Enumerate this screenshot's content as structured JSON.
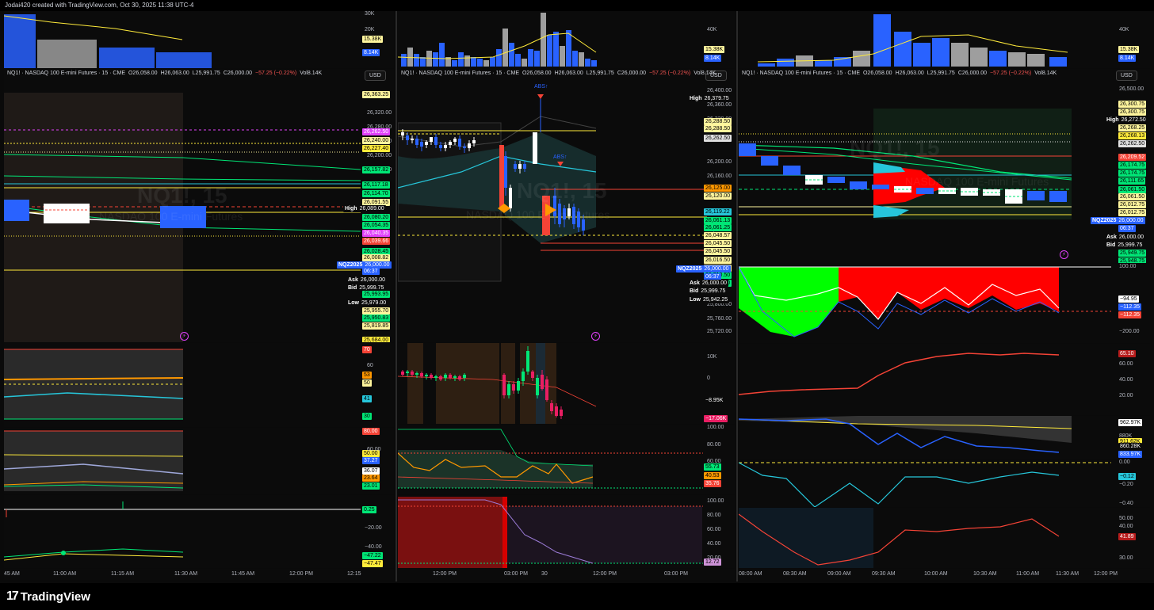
{
  "header": {
    "credit": "Jodai420 created with TradingView.com, Oct 30, 2025 11:38 UTC-4"
  },
  "footer": {
    "brand": "TradingView",
    "logo_icon": "tradingview-logo-icon"
  },
  "currency": "USD",
  "left": {
    "volume": {
      "ticks": [
        "30K",
        "20K",
        "10K"
      ],
      "tags": [
        "15.38K",
        "8.14K"
      ]
    },
    "price": {
      "legend": {
        "symbol": "NQ1! · NASDAQ 100 E-mini Futures · 15 · CME",
        "o": "O26,058.00",
        "h": "H26,063.00",
        "l": "L25,991.75",
        "c": "C26,000.00",
        "chg": "−57.25 (−0.22%)",
        "vol": "Vol8.14K"
      },
      "watermark": "NQ1!, 15",
      "watermark_sub": "NASDAQ 100 E-mini Futures",
      "ticks": [
        "26,320.00",
        "26,280.00",
        "26,240.00",
        "26,200.00",
        "26,160.00"
      ],
      "tags": [
        {
          "text": "26,363.25",
          "bg": "#fff59d",
          "fg": "#000"
        },
        {
          "text": "26,262.50",
          "bg": "#e040fb",
          "fg": "#fff"
        },
        {
          "text": "26,240.00",
          "bg": "#fff59d",
          "fg": "#000"
        },
        {
          "text": "26,227.40",
          "bg": "#ffeb3b",
          "fg": "#000"
        },
        {
          "text": "26,157.82",
          "bg": "#00e676",
          "fg": "#000"
        },
        {
          "text": "26,117.18",
          "bg": "#00e676",
          "fg": "#000"
        },
        {
          "text": "26,114.70",
          "bg": "#00e676",
          "fg": "#000"
        },
        {
          "text": "26,091.55",
          "bg": "#fff59d",
          "fg": "#000"
        },
        {
          "text": "26,089.00",
          "bg": "#0b0b0b",
          "fg": "#fff",
          "label": "High"
        },
        {
          "text": "26,080.20",
          "bg": "#00e676",
          "fg": "#000"
        },
        {
          "text": "26,054.35",
          "bg": "#00e676",
          "fg": "#000"
        },
        {
          "text": "26,040.35",
          "bg": "#e040fb",
          "fg": "#fff"
        },
        {
          "text": "26,039.66",
          "bg": "#f44336",
          "fg": "#fff"
        },
        {
          "text": "26,028.45",
          "bg": "#00e676",
          "fg": "#000"
        },
        {
          "text": "26,008.82",
          "bg": "#fff59d",
          "fg": "#000"
        },
        {
          "text": "26,000.00",
          "bg": "#2962ff",
          "fg": "#fff",
          "label": "NQZ2025"
        },
        {
          "text": "06:37",
          "bg": "#2962ff",
          "fg": "#fff"
        },
        {
          "text": "26,000.00",
          "bg": "#0b0b0b",
          "fg": "#fff",
          "label": "Ask"
        },
        {
          "text": "25,999.75",
          "bg": "#0b0b0b",
          "fg": "#fff",
          "label": "Bid"
        },
        {
          "text": "25,993.95",
          "bg": "#00e676",
          "fg": "#000"
        },
        {
          "text": "25,979.00",
          "bg": "#0b0b0b",
          "fg": "#fff",
          "label": "Low"
        },
        {
          "text": "25,955.70",
          "bg": "#fff59d",
          "fg": "#000"
        },
        {
          "text": "25,950.83",
          "bg": "#00e676",
          "fg": "#000"
        },
        {
          "text": "25,819.85",
          "bg": "#fff59d",
          "fg": "#000"
        },
        {
          "text": "25,684.00",
          "bg": "#ffeb3b",
          "fg": "#000"
        }
      ]
    },
    "rsi": {
      "ticks": [
        "70",
        "60",
        "53",
        "50",
        "41",
        "30"
      ],
      "tags": [
        "70",
        "53",
        "50",
        "41",
        "30"
      ]
    },
    "stoch": {
      "ticks": [
        "80.00",
        "60.00",
        "50.00",
        "37.27",
        "36.07",
        "23.64",
        "23.01"
      ]
    },
    "osc": {
      "ticks": [
        "0.25",
        "−20.00",
        "−40.00",
        "−47.22",
        "−47.47"
      ]
    },
    "time_axis": [
      "45 AM",
      "11:00 AM",
      "11:15 AM",
      "11:30 AM",
      "11:45 AM",
      "12:00 PM",
      "12:15"
    ]
  },
  "middle": {
    "volume": {
      "ticks": [
        "40K"
      ],
      "tags": [
        "15.38K",
        "8.14K"
      ]
    },
    "price": {
      "legend": {
        "symbol": "NQ1! · NASDAQ 100 E-mini Futures · 15 · CME",
        "o": "O26,058.00",
        "h": "H26,063.00",
        "l": "L25,991.75",
        "c": "C26,000.00",
        "chg": "−57.25 (−0.22%)",
        "vol": "Vol8.14K"
      },
      "watermark": "NQ1!, 15",
      "watermark_sub": "NASDAQ 100 E-mini Futures",
      "abs_labels": [
        "ABS↑",
        "ABS↑"
      ],
      "ticks": [
        "26,400.00",
        "26,360.00",
        "26,320.00",
        "26,280.00",
        "26,240.00",
        "26,200.00",
        "26,160.00",
        "26,080.00",
        "26,040.00",
        "25,800.00",
        "25,760.00",
        "25,720.00"
      ],
      "tags": [
        {
          "text": "26,379.75",
          "bg": "#0b0b0b",
          "fg": "#fff",
          "label": "High"
        },
        {
          "text": "26,288.50",
          "bg": "#fff59d",
          "fg": "#000"
        },
        {
          "text": "26,288.50",
          "bg": "#fff59d",
          "fg": "#000"
        },
        {
          "text": "26,262.50",
          "bg": "#e0e0e0",
          "fg": "#000"
        },
        {
          "text": "26,125.00",
          "bg": "#ff9800",
          "fg": "#000"
        },
        {
          "text": "26,120.00",
          "bg": "#fff59d",
          "fg": "#000"
        },
        {
          "text": "26,119.22",
          "bg": "#26c6da",
          "fg": "#000"
        },
        {
          "text": "26,061.13",
          "bg": "#00e676",
          "fg": "#000"
        },
        {
          "text": "26,061.25",
          "bg": "#00e676",
          "fg": "#000"
        },
        {
          "text": "26,048.57",
          "bg": "#fff59d",
          "fg": "#000"
        },
        {
          "text": "26,045.50",
          "bg": "#fff59d",
          "fg": "#000"
        },
        {
          "text": "26,045.50",
          "bg": "#fff59d",
          "fg": "#000"
        },
        {
          "text": "26,016.50",
          "bg": "#fff59d",
          "fg": "#000"
        },
        {
          "text": "26,016.50",
          "bg": "#fff59d",
          "fg": "#000"
        },
        {
          "text": "26,010.50",
          "bg": "#00e676",
          "fg": "#000"
        },
        {
          "text": "26,010.50",
          "bg": "#00e676",
          "fg": "#000"
        },
        {
          "text": "26,000.00",
          "bg": "#2962ff",
          "fg": "#fff",
          "label": "NQZ2025"
        },
        {
          "text": "06:37",
          "bg": "#2962ff",
          "fg": "#fff"
        },
        {
          "text": "26,000.00",
          "bg": "#0b0b0b",
          "fg": "#fff",
          "label": "Ask"
        },
        {
          "text": "25,999.75",
          "bg": "#0b0b0b",
          "fg": "#fff",
          "label": "Bid"
        },
        {
          "text": "25,942.25",
          "bg": "#0b0b0b",
          "fg": "#fff",
          "label": "Low"
        }
      ]
    },
    "delta": {
      "ticks": [
        "10K",
        "0"
      ],
      "tags": [
        "−8.95K",
        "−17.06K"
      ]
    },
    "rsi": {
      "ticks": [
        "100.00",
        "80.00",
        "60.00"
      ],
      "tags": [
        "55.73",
        "40.53",
        "35.76"
      ]
    },
    "stoch": {
      "ticks": [
        "100.00",
        "80.00",
        "60.00",
        "40.00",
        "20.00"
      ],
      "tags": [
        "12.72"
      ]
    },
    "time_axis": [
      "12:00 PM",
      "03:00 PM",
      "30",
      "12:00 PM",
      "03:00 PM"
    ]
  },
  "right": {
    "volume": {
      "ticks": [
        "40K"
      ],
      "tags": [
        "15.38K",
        "8.14K"
      ]
    },
    "price": {
      "legend": {
        "symbol": "NQ1! · NASDAQ 100 E-mini Futures · 15 · CME",
        "o": "O26,058.00",
        "h": "H26,063.00",
        "l": "L25,991.75",
        "c": "C26,000.00",
        "chg": "−57.25 (−0.22%)",
        "vol": "Vol8.14K"
      },
      "watermark": "NQ1!, 15",
      "watermark_sub": "NASDAQ 100 E-mini Futures",
      "ticks": [
        "26,500.00",
        "26,400.00"
      ],
      "tags": [
        {
          "text": "26,300.75",
          "bg": "#fff59d",
          "fg": "#000"
        },
        {
          "text": "26,300.75",
          "bg": "#fff59d",
          "fg": "#000"
        },
        {
          "text": "26,272.50",
          "bg": "#0b0b0b",
          "fg": "#fff",
          "label": "High"
        },
        {
          "text": "26,268.25",
          "bg": "#fff59d",
          "fg": "#000"
        },
        {
          "text": "26,268.13",
          "bg": "#ffeb3b",
          "fg": "#000"
        },
        {
          "text": "26,262.50",
          "bg": "#e0e0e0",
          "fg": "#000"
        },
        {
          "text": "26,209.52",
          "bg": "#f44336",
          "fg": "#fff"
        },
        {
          "text": "26,174.75",
          "bg": "#00e676",
          "fg": "#000"
        },
        {
          "text": "26,174.75",
          "bg": "#00e676",
          "fg": "#000"
        },
        {
          "text": "26,111.65",
          "bg": "#00e676",
          "fg": "#000"
        },
        {
          "text": "26,061.50",
          "bg": "#00e676",
          "fg": "#000"
        },
        {
          "text": "26,061.50",
          "bg": "#fff59d",
          "fg": "#000"
        },
        {
          "text": "26,012.75",
          "bg": "#fff59d",
          "fg": "#000"
        },
        {
          "text": "26,012.75",
          "bg": "#fff59d",
          "fg": "#000"
        },
        {
          "text": "26,000.00",
          "bg": "#2962ff",
          "fg": "#fff",
          "label": "NQZ2025"
        },
        {
          "text": "06:37",
          "bg": "#2962ff",
          "fg": "#fff"
        },
        {
          "text": "26,000.00",
          "bg": "#0b0b0b",
          "fg": "#fff",
          "label": "Ask"
        },
        {
          "text": "25,999.75",
          "bg": "#0b0b0b",
          "fg": "#fff",
          "label": "Bid"
        },
        {
          "text": "25,949.75",
          "bg": "#00e676",
          "fg": "#000"
        },
        {
          "text": "25,948.75",
          "bg": "#00e676",
          "fg": "#000"
        }
      ]
    },
    "cvd": {
      "ticks": [
        "100.00",
        "−200.00"
      ],
      "tags": [
        "−94.95",
        "−112.35",
        "−112.35"
      ]
    },
    "rsi": {
      "ticks": [
        "60.00",
        "40.00",
        "20.00"
      ],
      "tags": [
        "65.10"
      ]
    },
    "obv": {
      "ticks": [
        "880K"
      ],
      "tags": [
        "962.97K",
        "911.62K",
        "860.28K",
        "833.97K"
      ]
    },
    "macd": {
      "ticks": [
        "0.00",
        "−0.20",
        "−0.40"
      ],
      "tags": [
        "−0.12"
      ]
    },
    "rsi2": {
      "ticks": [
        "50.00",
        "40.00",
        "30.00"
      ],
      "tags": [
        "41.89"
      ]
    },
    "time_axis": [
      "08:00 AM",
      "08:30 AM",
      "09:00 AM",
      "09:30 AM",
      "10:00 AM",
      "10:30 AM",
      "11:00 AM",
      "11:30 AM",
      "12:00 PM"
    ]
  }
}
